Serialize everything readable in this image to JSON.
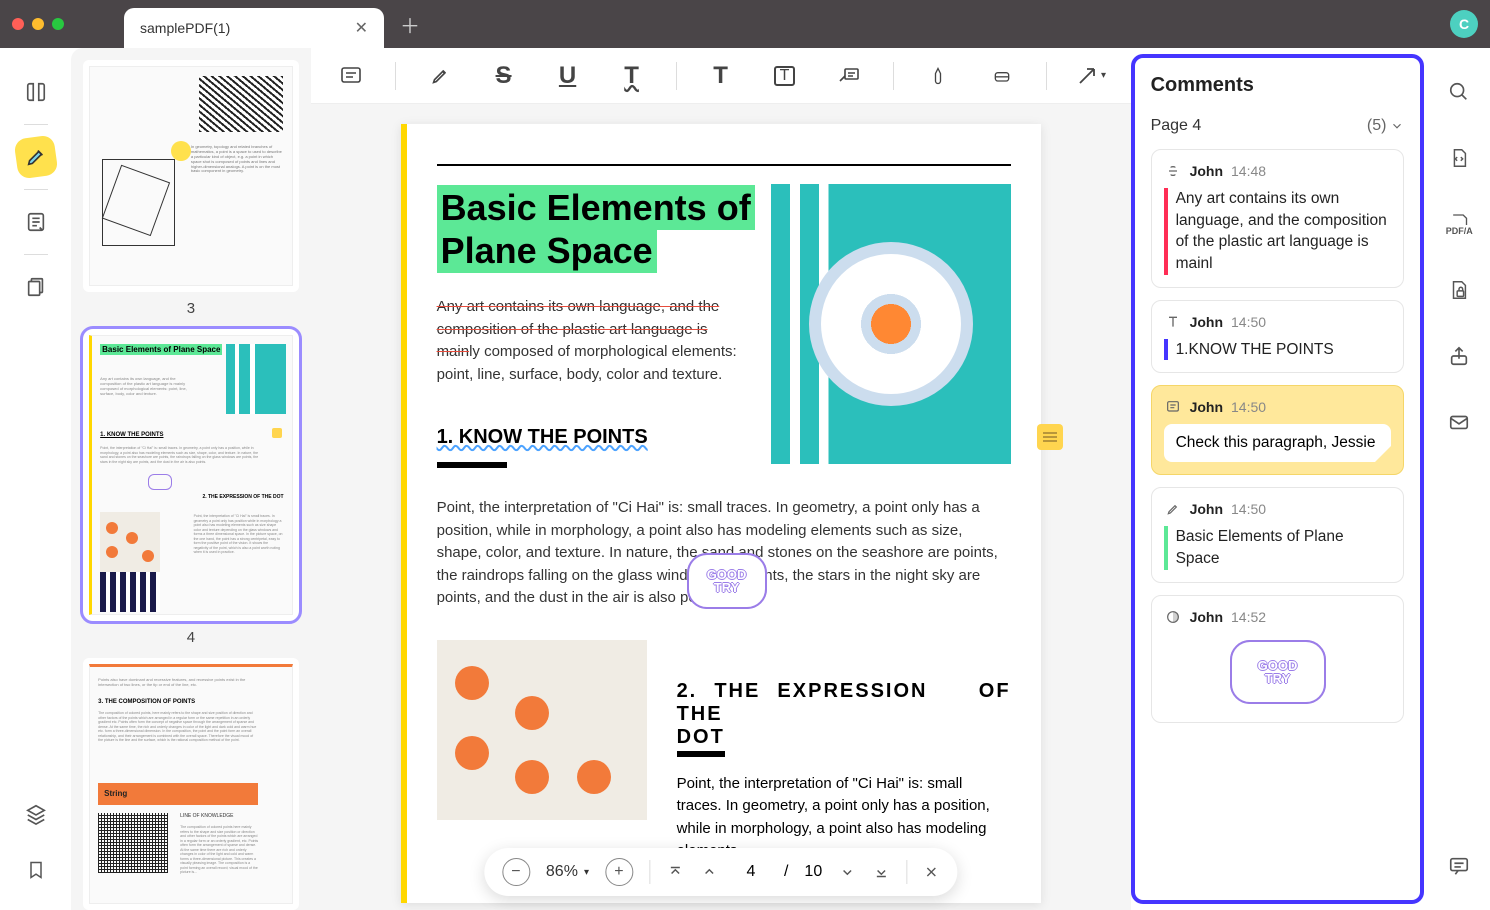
{
  "tab": {
    "title": "samplePDF(1)"
  },
  "avatar": {
    "initial": "C"
  },
  "thumbs": {
    "p3": "3",
    "p4": "4",
    "p4_title": "Basic Elements of Plane Space",
    "p5_string": "String"
  },
  "doc": {
    "title_l1": "Basic Elements of",
    "title_l2": "Plane Space",
    "para1_strike": "Any art contains its own language, and the composition of the plastic art language is main",
    "para1_rest": "ly composed of morphological elements: point, line, surface, body, color and texture.",
    "h2_1": "1. KNOW THE POINTS",
    "para2": "Point, the interpretation of \"Ci Hai\" is: small traces. In geometry, a point only has a position, while in morphology, a point also has modeling elements such as size, shape, color, and texture. In nature, the sand and stones on the seashore are points, the raindrops falling on the glass windows are points, the stars in the night sky are points, and the dust in the air is also points.",
    "h2_2a": "2. THE EXPRESSION",
    "h2_2b": "OF THE",
    "h2_2c": "DOT",
    "para3": "Point, the interpretation of \"Ci Hai\" is: small traces. In geometry, a point only has a position, while in morphology, a point also has modeling elements",
    "sticker_l1": "GOOD",
    "sticker_l2": "TRY"
  },
  "bottombar": {
    "zoom": "86%",
    "page_current": "4",
    "page_sep": "/",
    "page_total": "10"
  },
  "comments": {
    "title": "Comments",
    "page_label": "Page 4",
    "count": "(5)",
    "items": [
      {
        "author": "John",
        "time": "14:48",
        "body": "Any art contains its own language, and the composition of the plastic art language is mainl"
      },
      {
        "author": "John",
        "time": "14:50",
        "body": "1.KNOW THE POINTS"
      },
      {
        "author": "John",
        "time": "14:50",
        "body": "Check this paragraph, Jessie"
      },
      {
        "author": "John",
        "time": "14:50",
        "body": "Basic Elements of Plane Space"
      },
      {
        "author": "John",
        "time": "14:52",
        "body_sticker_l1": "GOOD",
        "body_sticker_l2": "TRY"
      }
    ]
  },
  "tool_letters": {
    "s": "S",
    "u": "U",
    "tsq": "T",
    "t": "T",
    "tbox": "T"
  }
}
